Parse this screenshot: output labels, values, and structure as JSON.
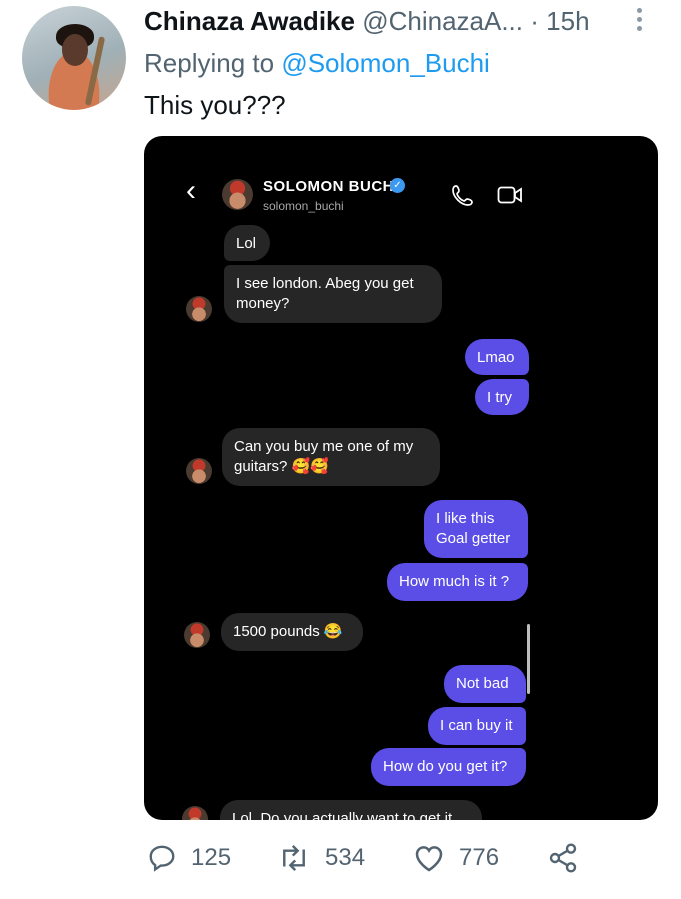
{
  "tweet": {
    "author_name": "Chinaza Awadike",
    "author_handle": "@ChinazaA...",
    "separator": "·",
    "time": "15h",
    "replying_prefix": "Replying to",
    "replying_to": "@Solomon_Buchi",
    "text": "This you???"
  },
  "chat": {
    "contact_name": "SOLOMON BUCHI",
    "contact_username": "solomon_buchi",
    "messages": [
      {
        "side": "in",
        "text": "Lol"
      },
      {
        "side": "in",
        "text": "I see london. Abeg you get\nmoney?"
      },
      {
        "side": "out",
        "text": "Lmao"
      },
      {
        "side": "out",
        "text": "I try"
      },
      {
        "side": "in",
        "text": "Can you buy me one of my\nguitars? 🥰🥰"
      },
      {
        "side": "out",
        "text": "I like this\nGoal getter"
      },
      {
        "side": "out",
        "text": "How much is it ?"
      },
      {
        "side": "in",
        "text": "1500 pounds 😂"
      },
      {
        "side": "out",
        "text": "Not bad"
      },
      {
        "side": "out",
        "text": "I can buy it"
      },
      {
        "side": "out",
        "text": "How do you get it?"
      },
      {
        "side": "in",
        "text": "Lol. Do you actually want to get it"
      }
    ]
  },
  "actions": {
    "replies": "125",
    "retweets": "534",
    "likes": "776"
  },
  "icons": [
    "kebab-menu-icon",
    "back-chevron-icon",
    "verified-badge-icon",
    "phone-icon",
    "video-camera-icon",
    "reply-icon",
    "retweet-icon",
    "like-icon",
    "share-icon"
  ],
  "colors": {
    "link": "#1d9bf0",
    "outgoing_bubble": "#5b4ee6",
    "incoming_bubble": "#262626"
  }
}
